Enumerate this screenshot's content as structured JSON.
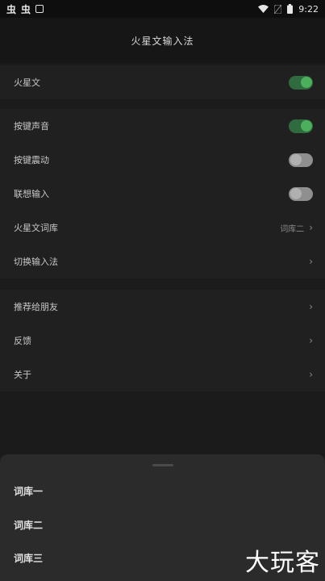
{
  "status_bar": {
    "left_glyphs": [
      "虫",
      "虫"
    ],
    "time": "9:22",
    "icons": [
      "notification-box-icon",
      "wifi-icon",
      "no-sim-icon",
      "battery-icon"
    ]
  },
  "header": {
    "title": "火星文输入法"
  },
  "group1": {
    "items": [
      {
        "label": "火星文",
        "toggle": true
      }
    ]
  },
  "group2": {
    "items": [
      {
        "label": "按键声音",
        "toggle": true
      },
      {
        "label": "按键震动",
        "toggle": false
      },
      {
        "label": "联想输入",
        "toggle": false
      },
      {
        "label": "火星文词库",
        "value": "词库二",
        "chevron": "›"
      },
      {
        "label": "切换输入法",
        "chevron": "›"
      }
    ]
  },
  "group3": {
    "items": [
      {
        "label": "推荐给朋友",
        "chevron": "›"
      },
      {
        "label": "反馈",
        "chevron": "›"
      },
      {
        "label": "关于",
        "chevron": "›"
      }
    ]
  },
  "sheet": {
    "options": [
      "词库一",
      "词库二",
      "词库三"
    ]
  },
  "watermark": "大玩客",
  "colors": {
    "toggle_on_track": "#2f6b3f",
    "toggle_on_knob": "#4caf5c",
    "toggle_off_track": "#8f8f8f",
    "background": "#1b1b1b"
  }
}
